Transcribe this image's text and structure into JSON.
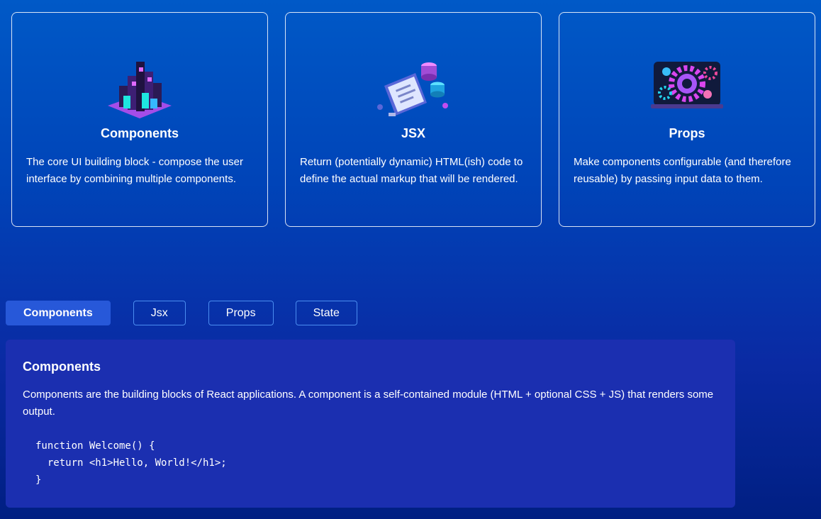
{
  "concepts": [
    {
      "title": "Components",
      "description": "The core UI building block - compose the user interface by combining multiple components.",
      "image_icon": "components-image"
    },
    {
      "title": "JSX",
      "description": "Return (potentially dynamic) HTML(ish) code to define the actual markup that will be rendered.",
      "image_icon": "jsx-image"
    },
    {
      "title": "Props",
      "description": "Make components configurable (and therefore reusable) by passing input data to them.",
      "image_icon": "props-image"
    }
  ],
  "tabs": [
    {
      "label": "Components",
      "active": true
    },
    {
      "label": "Jsx",
      "active": false
    },
    {
      "label": "Props",
      "active": false
    },
    {
      "label": "State",
      "active": false
    }
  ],
  "tab_content": {
    "title": "Components",
    "description": "Components are the building blocks of React applications. A component is a self-contained module (HTML + optional CSS + JS) that renders some output.",
    "code_lines": [
      "function Welcome() {",
      "  return <h1>Hello, World!</h1>;",
      "}"
    ]
  },
  "colors": {
    "background_top": "#0059c7",
    "background_bottom": "#001f82",
    "active_tab": "#2758d9",
    "tab_border": "#4b8df0",
    "content_panel": "#1b2fb0"
  }
}
